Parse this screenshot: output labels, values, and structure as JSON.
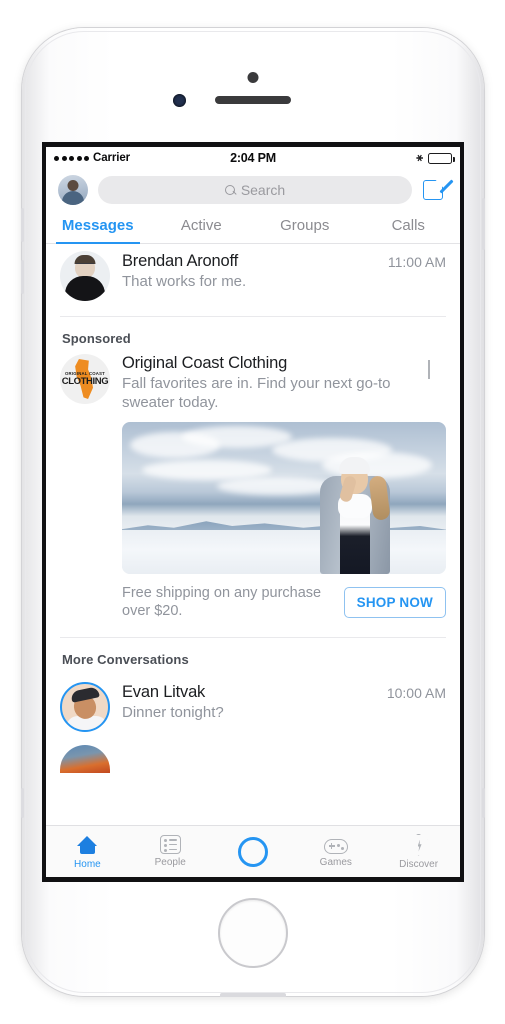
{
  "status_bar": {
    "carrier": "Carrier",
    "signal_dots": 5,
    "time": "2:04 PM",
    "bluetooth_icon": "bluetooth-icon",
    "battery_icon": "battery-full-icon"
  },
  "header": {
    "avatar_name": "user-avatar",
    "search_placeholder": "Search",
    "search_icon": "search-icon",
    "compose_icon": "compose-icon"
  },
  "tabs": [
    {
      "label": "Messages",
      "active": true
    },
    {
      "label": "Active",
      "active": false
    },
    {
      "label": "Groups",
      "active": false
    },
    {
      "label": "Calls",
      "active": false
    }
  ],
  "conversations_top": [
    {
      "name": "Brendan Aronoff",
      "snippet": "That works for me.",
      "time": "11:00 AM"
    }
  ],
  "sponsored": {
    "section_label": "Sponsored",
    "brand": "Original Coast Clothing",
    "logo_text_top": "ORIGINAL COAST",
    "logo_text_main": "CLOTHING",
    "description": "Fall favorites are in. Find your next go-to sweater today.",
    "chevron_icon": "chevron-down-icon",
    "offer": "Free shipping on any purchase over $20.",
    "cta_label": "SHOP NOW",
    "accent_color": "#2595f2",
    "logo_color": "#ee8c21"
  },
  "more_conversations": {
    "section_label": "More Conversations",
    "items": [
      {
        "name": "Evan Litvak",
        "snippet": "Dinner tonight?",
        "time": "10:00 AM",
        "has_story_ring": true
      }
    ]
  },
  "tabbar": [
    {
      "label": "Home",
      "icon": "home-icon",
      "active": true
    },
    {
      "label": "People",
      "icon": "people-list-icon",
      "active": false
    },
    {
      "label": "",
      "icon": "camera-circle-icon",
      "active": false
    },
    {
      "label": "Games",
      "icon": "game-controller-icon",
      "active": false
    },
    {
      "label": "Discover",
      "icon": "discover-bolt-icon",
      "active": false
    }
  ]
}
